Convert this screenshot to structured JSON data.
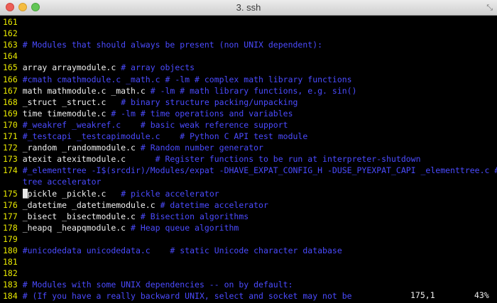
{
  "window": {
    "title": "3. ssh",
    "resize_glyph": "⤡"
  },
  "lines": [
    {
      "num": "161",
      "parts": []
    },
    {
      "num": "162",
      "parts": []
    },
    {
      "num": "163",
      "parts": [
        {
          "t": "# Modules that should always be present (non UNIX dependent):",
          "c": "comment"
        }
      ]
    },
    {
      "num": "164",
      "parts": []
    },
    {
      "num": "165",
      "parts": [
        {
          "t": "array arraymodule.c ",
          "c": "code"
        },
        {
          "t": "# array objects",
          "c": "comment"
        }
      ]
    },
    {
      "num": "166",
      "parts": [
        {
          "t": "#cmath cmathmodule.c _math.c # -lm # complex math library functions",
          "c": "comment"
        }
      ]
    },
    {
      "num": "167",
      "parts": [
        {
          "t": "math mathmodule.c _math.c ",
          "c": "code"
        },
        {
          "t": "# -lm # math library functions, e.g. sin()",
          "c": "comment"
        }
      ]
    },
    {
      "num": "168",
      "parts": [
        {
          "t": "_struct _struct.c   ",
          "c": "code"
        },
        {
          "t": "# binary structure packing/unpacking",
          "c": "comment"
        }
      ]
    },
    {
      "num": "169",
      "parts": [
        {
          "t": "time timemodule.c ",
          "c": "code"
        },
        {
          "t": "# -lm # time operations and variables",
          "c": "comment"
        }
      ]
    },
    {
      "num": "170",
      "parts": [
        {
          "t": "#_weakref _weakref.c    # basic weak reference support",
          "c": "comment"
        }
      ]
    },
    {
      "num": "171",
      "parts": [
        {
          "t": "#_testcapi _testcapimodule.c    # Python C API test module",
          "c": "comment"
        }
      ]
    },
    {
      "num": "172",
      "parts": [
        {
          "t": "_random _randommodule.c ",
          "c": "code"
        },
        {
          "t": "# Random number generator",
          "c": "comment"
        }
      ]
    },
    {
      "num": "173",
      "parts": [
        {
          "t": "atexit atexitmodule.c      ",
          "c": "code"
        },
        {
          "t": "# Register functions to be run at interpreter-shutdown",
          "c": "comment"
        }
      ]
    },
    {
      "num": "174",
      "parts": [
        {
          "t": "#_elementtree -I$(srcdir)/Modules/expat -DHAVE_EXPAT_CONFIG_H -DUSE_PYEXPAT_CAPI _elementtree.c # elemen",
          "c": "comment"
        }
      ]
    },
    {
      "num": "",
      "parts": [
        {
          "t": "tree accelerator",
          "c": "comment"
        }
      ]
    },
    {
      "num": "175",
      "parts": [
        {
          "t": "_",
          "c": "cursor"
        },
        {
          "t": "pickle _pickle.c   ",
          "c": "code"
        },
        {
          "t": "# pickle accelerator",
          "c": "comment"
        }
      ]
    },
    {
      "num": "176",
      "parts": [
        {
          "t": "_datetime _datetimemodule.c ",
          "c": "code"
        },
        {
          "t": "# datetime accelerator",
          "c": "comment"
        }
      ]
    },
    {
      "num": "177",
      "parts": [
        {
          "t": "_bisect _bisectmodule.c ",
          "c": "code"
        },
        {
          "t": "# Bisection algorithms",
          "c": "comment"
        }
      ]
    },
    {
      "num": "178",
      "parts": [
        {
          "t": "_heapq _heapqmodule.c ",
          "c": "code"
        },
        {
          "t": "# Heap queue algorithm",
          "c": "comment"
        }
      ]
    },
    {
      "num": "179",
      "parts": []
    },
    {
      "num": "180",
      "parts": [
        {
          "t": "#unicodedata unicodedata.c    # static Unicode character database",
          "c": "comment"
        }
      ]
    },
    {
      "num": "181",
      "parts": []
    },
    {
      "num": "182",
      "parts": []
    },
    {
      "num": "183",
      "parts": [
        {
          "t": "# Modules with some UNIX dependencies -- on by default:",
          "c": "comment"
        }
      ]
    },
    {
      "num": "184",
      "parts": [
        {
          "t": "# (If you have a really backward UNIX, select and socket may not be",
          "c": "comment"
        }
      ]
    }
  ],
  "status": {
    "position": "175,1",
    "percent": "43%"
  }
}
